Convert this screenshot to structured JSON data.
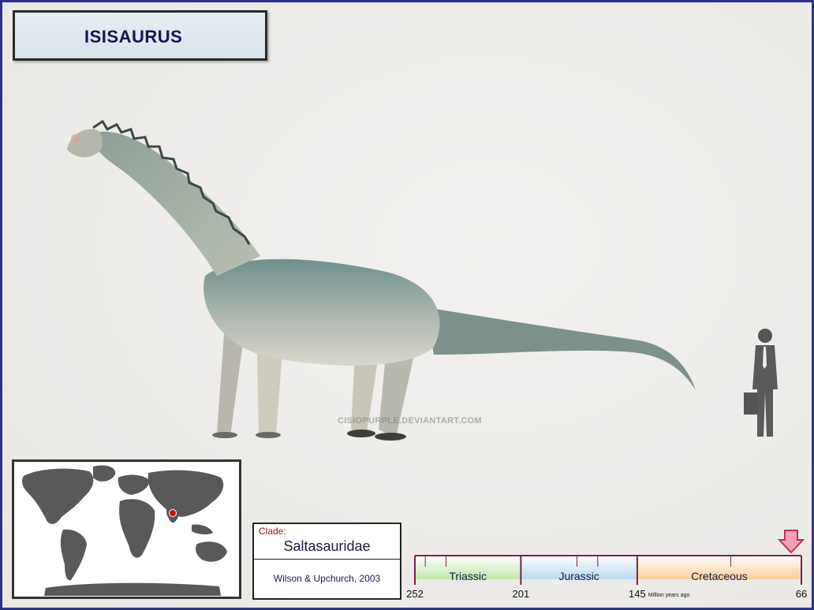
{
  "title": "ISISAURUS",
  "watermark": "CISIOPURPLE.DEVIANTART.COM",
  "clade": {
    "label": "Clade:",
    "name": "Saltasauridae",
    "author": "Wilson & Upchurch, 2003"
  },
  "timeline": {
    "periods": [
      {
        "name": "Triassic",
        "start": 252,
        "end": 201,
        "color": "#bfe6a8"
      },
      {
        "name": "Jurassic",
        "start": 201,
        "end": 145,
        "color": "#b9d9ee"
      },
      {
        "name": "Cretaceous",
        "start": 145,
        "end": 66,
        "color": "#f8cf96"
      }
    ],
    "tick_labels": [
      "252",
      "201",
      "145",
      "66"
    ],
    "unit_label": "Million years ago",
    "marker_value": 66,
    "marker_color": "#f4a0b0"
  },
  "map": {
    "location_marker": "India",
    "marker_color": "#d01010"
  },
  "colors": {
    "frame": "#2f2f8f",
    "title_text": "#14145a",
    "clade_label": "#8a1414"
  }
}
